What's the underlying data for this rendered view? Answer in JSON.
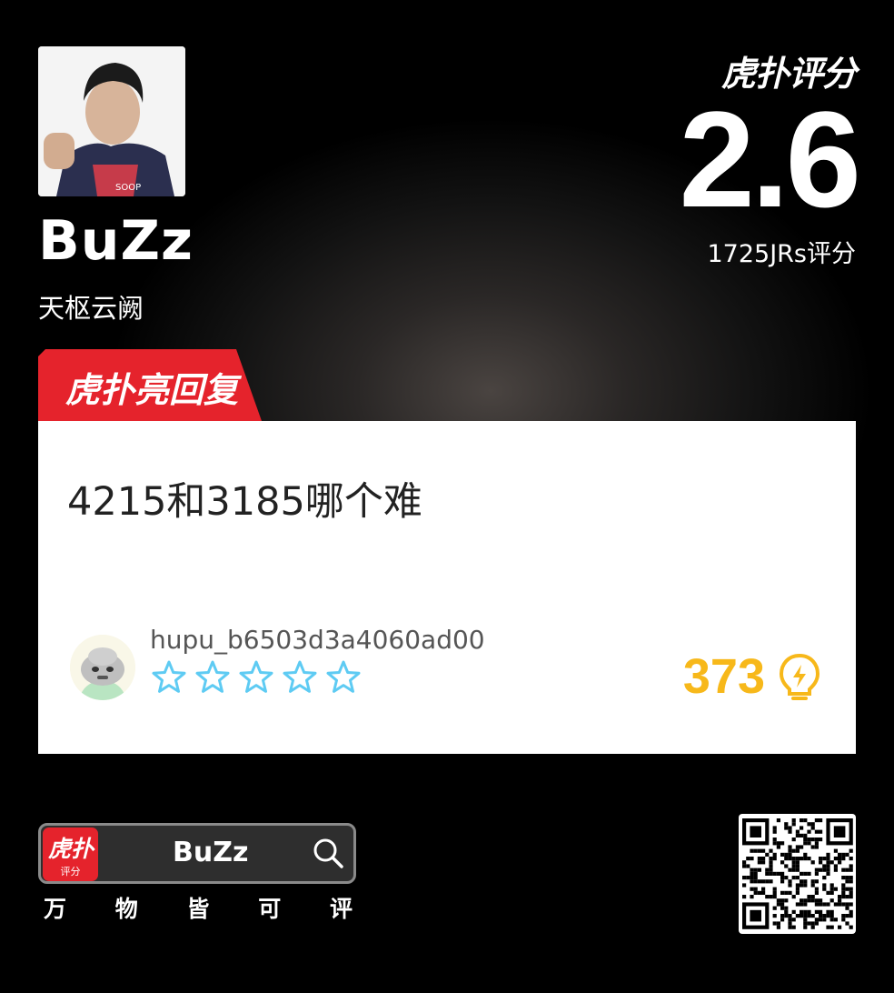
{
  "player": {
    "name": "BuZz",
    "team": "天枢云阙"
  },
  "rating": {
    "brand": "虎扑评分",
    "score": "2.6",
    "count_label": "1725JRs评分"
  },
  "highlight": {
    "banner": "虎扑亮回复",
    "question": "4215和3185哪个难",
    "username": "hupu_b6503d3a4060ad00",
    "stars": 0,
    "star_total": 5,
    "likes": "373",
    "accent": "#f7b81a",
    "star_color": "#5ecbf3"
  },
  "footer": {
    "app_icon_top": "虎扑",
    "app_icon_bottom": "评分",
    "search_text": "BuZz",
    "slogan": [
      "万",
      "物",
      "皆",
      "可",
      "评"
    ]
  },
  "colors": {
    "brand_red": "#e5232c"
  }
}
